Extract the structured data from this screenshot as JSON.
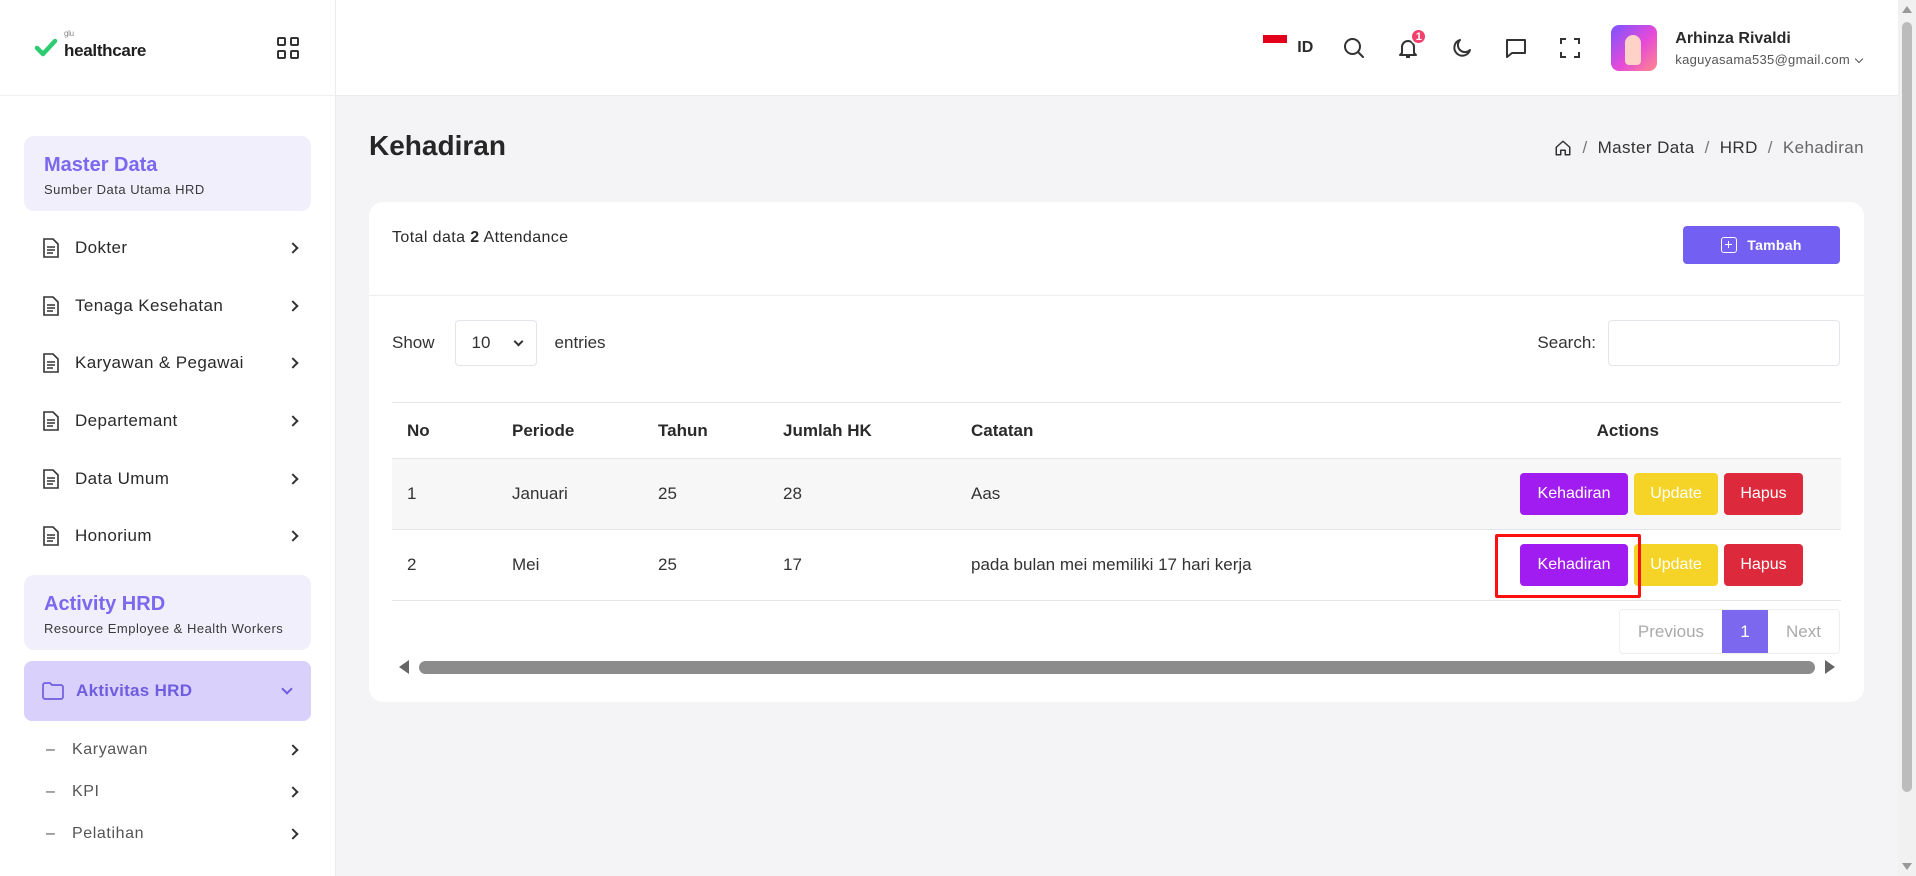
{
  "logo": {
    "small": "glu",
    "text": "healthcare"
  },
  "sidebar": {
    "master_section": {
      "title": "Master Data",
      "subtitle": "Sumber Data Utama HRD"
    },
    "master_items": [
      {
        "label": "Dokter"
      },
      {
        "label": "Tenaga Kesehatan"
      },
      {
        "label": "Karyawan & Pegawai"
      },
      {
        "label": "Departemant"
      },
      {
        "label": "Data Umum"
      },
      {
        "label": "Honorium"
      }
    ],
    "activity_section": {
      "title": "Activity HRD",
      "subtitle": "Resource Employee & Health Workers"
    },
    "active_group": {
      "label": "Aktivitas HRD"
    },
    "sub_items": [
      {
        "label": "Karyawan"
      },
      {
        "label": "KPI"
      },
      {
        "label": "Pelatihan"
      }
    ]
  },
  "header": {
    "lang": "ID",
    "notif_count": "1",
    "user": {
      "name": "Arhinza Rivaldi",
      "email": "kaguyasama535@gmail.com"
    }
  },
  "page": {
    "title": "Kehadiran",
    "breadcrumb": [
      "Master Data",
      "HRD",
      "Kehadiran"
    ]
  },
  "card": {
    "total_prefix": "Total data",
    "total_count": "2",
    "total_suffix": "Attendance",
    "add_label": "Tambah",
    "show_label": "Show",
    "entries_value": "10",
    "entries_label": "entries",
    "search_label": "Search:"
  },
  "table": {
    "headers": [
      "No",
      "Periode",
      "Tahun",
      "Jumlah HK",
      "Catatan",
      "Actions"
    ],
    "rows": [
      {
        "no": "1",
        "periode": "Januari",
        "tahun": "25",
        "jumlah_hk": "28",
        "catatan": "Aas"
      },
      {
        "no": "2",
        "periode": "Mei",
        "tahun": "25",
        "jumlah_hk": "17",
        "catatan": "pada bulan mei memiliki 17 hari kerja"
      }
    ],
    "actions": {
      "kehadiran": "Kehadiran",
      "update": "Update",
      "hapus": "Hapus"
    }
  },
  "pagination": {
    "previous": "Previous",
    "current": "1",
    "next": "Next"
  },
  "colors": {
    "accent": "#7360f2",
    "kehadiran": "#a01cf0",
    "update": "#f5d327",
    "hapus": "#dc2a3c",
    "highlight": "#ff1010"
  }
}
